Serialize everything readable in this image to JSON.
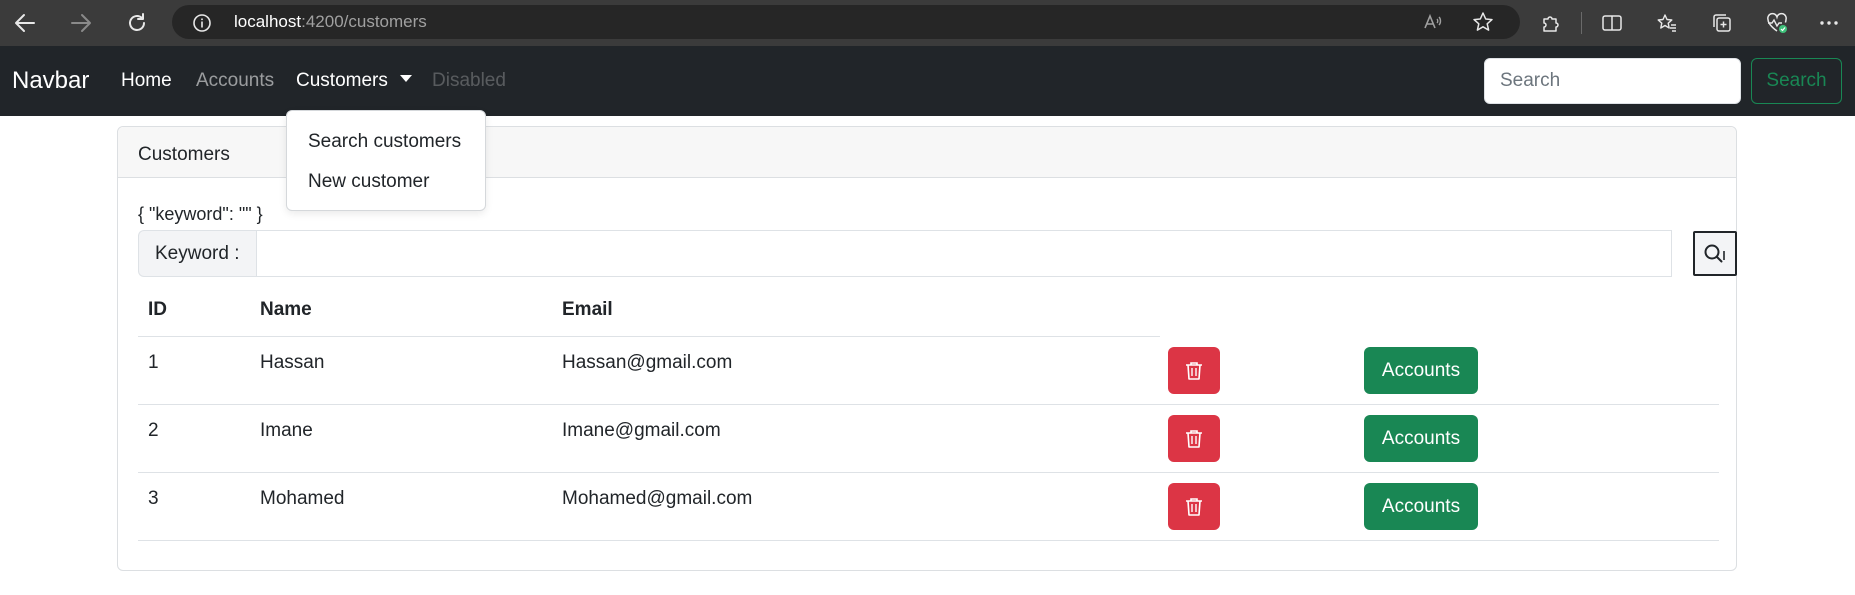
{
  "browser": {
    "url_host": "localhost",
    "url_path": ":4200/customers"
  },
  "navbar": {
    "brand": "Navbar",
    "links": {
      "home": "Home",
      "accounts": "Accounts",
      "customers": "Customers",
      "disabled": "Disabled"
    },
    "search_placeholder": "Search",
    "search_button": "Search"
  },
  "dropdown": {
    "items": [
      "Search customers",
      "New customer"
    ]
  },
  "card": {
    "header": "Customers",
    "keyword_json": "{ \"keyword\": \"\" }",
    "keyword_label": "Keyword :",
    "keyword_value": ""
  },
  "table": {
    "headers": [
      "ID",
      "Name",
      "Email"
    ],
    "rows": [
      {
        "id": "1",
        "name": "Hassan",
        "email": "Hassan@gmail.com",
        "accounts_label": "Accounts"
      },
      {
        "id": "2",
        "name": "Imane",
        "email": "Imane@gmail.com",
        "accounts_label": "Accounts"
      },
      {
        "id": "3",
        "name": "Mohamed",
        "email": "Mohamed@gmail.com",
        "accounts_label": "Accounts"
      }
    ]
  },
  "icons": {
    "delete": "trash-icon",
    "search": "search-icon"
  },
  "colors": {
    "navbar_bg": "#212529",
    "success": "#198754",
    "danger": "#dc3545",
    "chrome_bg": "#3b3b3b"
  }
}
